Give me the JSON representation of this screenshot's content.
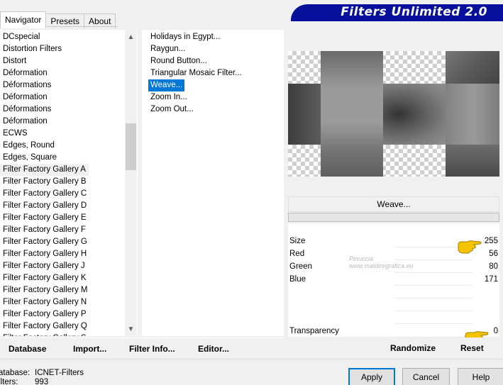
{
  "tabs": [
    {
      "label": "Navigator",
      "active": true
    },
    {
      "label": "Presets",
      "active": false
    },
    {
      "label": "About",
      "active": false
    }
  ],
  "banner_title": "Filters Unlimited 2.0",
  "categories": [
    "DCspecial",
    "Distortion Filters",
    "Distort",
    "Déformation",
    "Déformations",
    "Déformation",
    "Déformations",
    "Déformation",
    "ECWS",
    "Edges, Round",
    "Edges, Square",
    "Filter Factory Gallery A",
    "Filter Factory Gallery B",
    "Filter Factory Gallery C",
    "Filter Factory Gallery D",
    "Filter Factory Gallery E",
    "Filter Factory Gallery F",
    "Filter Factory Gallery G",
    "Filter Factory Gallery H",
    "Filter Factory Gallery J",
    "Filter Factory Gallery K",
    "Filter Factory Gallery M",
    "Filter Factory Gallery N",
    "Filter Factory Gallery P",
    "Filter Factory Gallery Q",
    "Filter Factory Gallery S"
  ],
  "selected_category": "Filter Factory Gallery A",
  "filters": [
    "Holidays in Egypt...",
    "Raygun...",
    "Round Button...",
    "Triangular Mosaic Filter...",
    "Weave...",
    "Zoom In...",
    "Zoom Out..."
  ],
  "selected_filter": "Weave...",
  "filter_name_button": "Weave...",
  "params": [
    {
      "label": "Size",
      "value": "255"
    },
    {
      "label": "Red",
      "value": "56"
    },
    {
      "label": "Green",
      "value": "80"
    },
    {
      "label": "Blue",
      "value": "171"
    },
    {
      "label": "",
      "value": ""
    },
    {
      "label": "",
      "value": ""
    },
    {
      "label": "",
      "value": ""
    },
    {
      "label": "Transparency",
      "value": "0"
    }
  ],
  "watermark": {
    "line1": "Pinuccia",
    "line2": "www.maldiregrafica.eu"
  },
  "action_buttons": {
    "database": "Database",
    "import": "Import...",
    "filter_info": "Filter Info...",
    "editor": "Editor...",
    "randomize": "Randomize",
    "reset": "Reset"
  },
  "footer": {
    "database_label": "atabase:",
    "database_value": "ICNET-Filters",
    "filters_label": "ilters:",
    "filters_value": "993"
  },
  "dialog_buttons": {
    "apply": "Apply",
    "cancel": "Cancel",
    "help": "Help"
  },
  "colors": {
    "banner": "#07109a",
    "selection": "#0078d7",
    "pointer_hand": "#f5c400"
  }
}
